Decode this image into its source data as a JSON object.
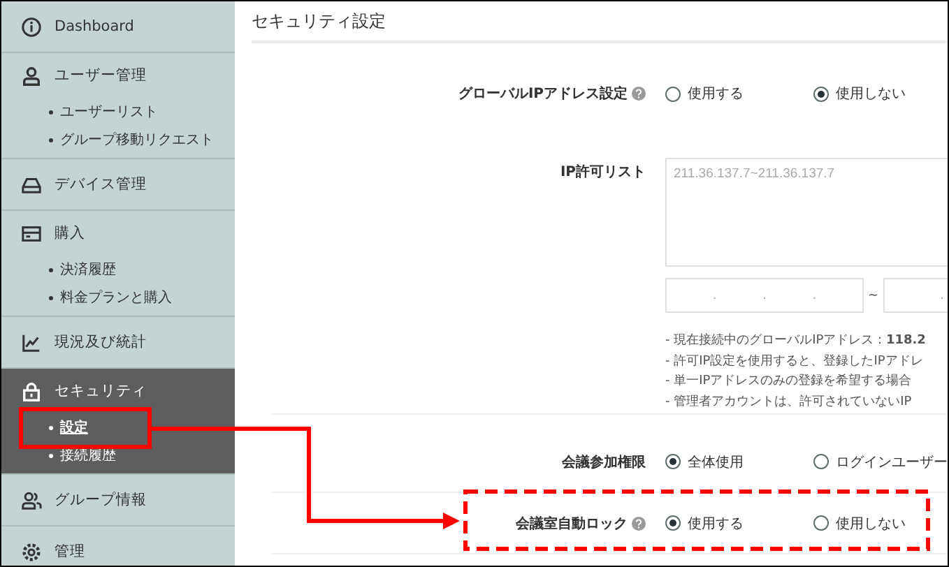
{
  "sidebar": {
    "items": [
      {
        "label": "Dashboard",
        "selected": false
      },
      {
        "label": "ユーザー管理",
        "selected": false,
        "children": [
          {
            "label": "ユーザーリスト",
            "selected": false
          },
          {
            "label": "グループ移動リクエスト",
            "selected": false
          }
        ]
      },
      {
        "label": "デバイス管理",
        "selected": false
      },
      {
        "label": "購入",
        "selected": false,
        "children": [
          {
            "label": "決済履歴",
            "selected": false
          },
          {
            "label": "料金プランと購入",
            "selected": false
          }
        ]
      },
      {
        "label": "現況及び統計",
        "selected": false
      },
      {
        "label": "セキュリティ",
        "selected": true,
        "children": [
          {
            "label": "設定",
            "selected": true
          },
          {
            "label": "接続履歴",
            "selected": false
          }
        ]
      },
      {
        "label": "グループ情報",
        "selected": false
      },
      {
        "label": "管理",
        "selected": false
      }
    ]
  },
  "page_title": "セキュリティ設定",
  "settings": [
    {
      "kind": "radio",
      "label": "グローバルIPアドレス設定",
      "help": true,
      "options": [
        {
          "label": "使用する",
          "selected": false
        },
        {
          "label": "使用しない",
          "selected": true
        }
      ]
    },
    {
      "kind": "ip_list",
      "label": "IP許可リスト",
      "help": false,
      "placeholder": "211.36.137.7~211.36.137.7",
      "range_from": [
        ".",
        ".",
        "."
      ],
      "range_separator": "~",
      "range_to": [
        "."
      ],
      "notes": [
        "- 現在接続中のグローバルIPアドレス : **118.2**",
        "- 許可IP設定を使用すると、登録したIPアドレ",
        "- 単一IPアドレスのみの登録を希望する場合",
        "- 管理者アカウントは、許可されていないIP"
      ]
    },
    {
      "kind": "radio",
      "label": "会議参加権限",
      "help": false,
      "options": [
        {
          "label": "全体使用",
          "selected": true
        },
        {
          "label": "ログインユーザー",
          "selected": false
        }
      ]
    },
    {
      "kind": "radio",
      "label": "会議室自動ロック",
      "help": true,
      "options": [
        {
          "label": "使用する",
          "selected": true
        },
        {
          "label": "使用しない",
          "selected": false
        }
      ]
    }
  ]
}
